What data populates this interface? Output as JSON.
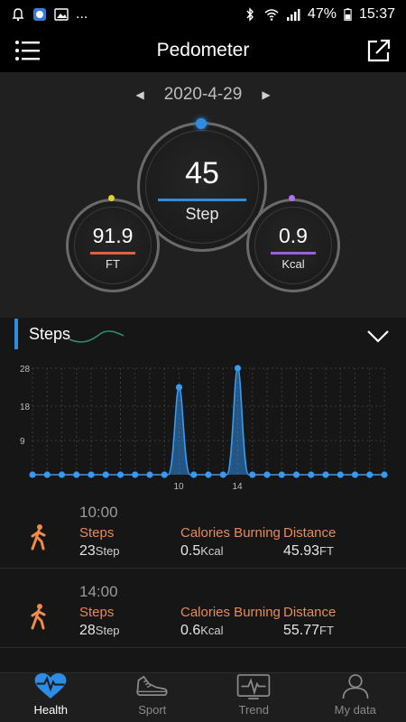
{
  "status_bar": {
    "left_extra": "...",
    "battery": "47%",
    "time": "15:37"
  },
  "header": {
    "title": "Pedometer"
  },
  "summary": {
    "date": "2020-4-29",
    "steps_value": "45",
    "steps_unit": "Step",
    "distance_value": "91.9",
    "distance_unit": "FT",
    "calories_value": "0.9",
    "calories_unit": "Kcal"
  },
  "steps_section": {
    "title": "Steps"
  },
  "chart_data": {
    "type": "area",
    "y_ticks": [
      "28",
      "18",
      "9"
    ],
    "ylim": [
      0,
      28
    ],
    "x_labels": [
      {
        "x": 10,
        "label": "10"
      },
      {
        "x": 14,
        "label": "14"
      }
    ],
    "x": [
      0,
      1,
      2,
      3,
      4,
      5,
      6,
      7,
      8,
      9,
      10,
      11,
      12,
      13,
      14,
      15,
      16,
      17,
      18,
      19,
      20,
      21,
      22,
      23,
      24
    ],
    "values": [
      0,
      0,
      0,
      0,
      0,
      0,
      0,
      0,
      0,
      0,
      23,
      0,
      0,
      0,
      28,
      0,
      0,
      0,
      0,
      0,
      0,
      0,
      0,
      0,
      0
    ],
    "grid": true
  },
  "records": [
    {
      "time": "10:00",
      "steps_label": "Steps",
      "steps_value": "23",
      "steps_unit": "Step",
      "calories_label": "Calories Burning",
      "calories_value": "0.5",
      "calories_unit": "Kcal",
      "distance_label": "Distance",
      "distance_value": "45.93",
      "distance_unit": "FT"
    },
    {
      "time": "14:00",
      "steps_label": "Steps",
      "steps_value": "28",
      "steps_unit": "Step",
      "calories_label": "Calories Burning",
      "calories_value": "0.6",
      "calories_unit": "Kcal",
      "distance_label": "Distance",
      "distance_value": "55.77",
      "distance_unit": "FT"
    }
  ],
  "tabs": [
    {
      "label": "Health",
      "icon": "heart-pulse-icon",
      "active": true
    },
    {
      "label": "Sport",
      "icon": "shoe-icon",
      "active": false
    },
    {
      "label": "Trend",
      "icon": "trend-icon",
      "active": false
    },
    {
      "label": "My data",
      "icon": "person-icon",
      "active": false
    }
  ],
  "colors": {
    "accent_blue": "#2f8de0",
    "distance_orange": "#e0603c",
    "calories_purple": "#9a5fe0",
    "record_label": "#e88a5a"
  }
}
